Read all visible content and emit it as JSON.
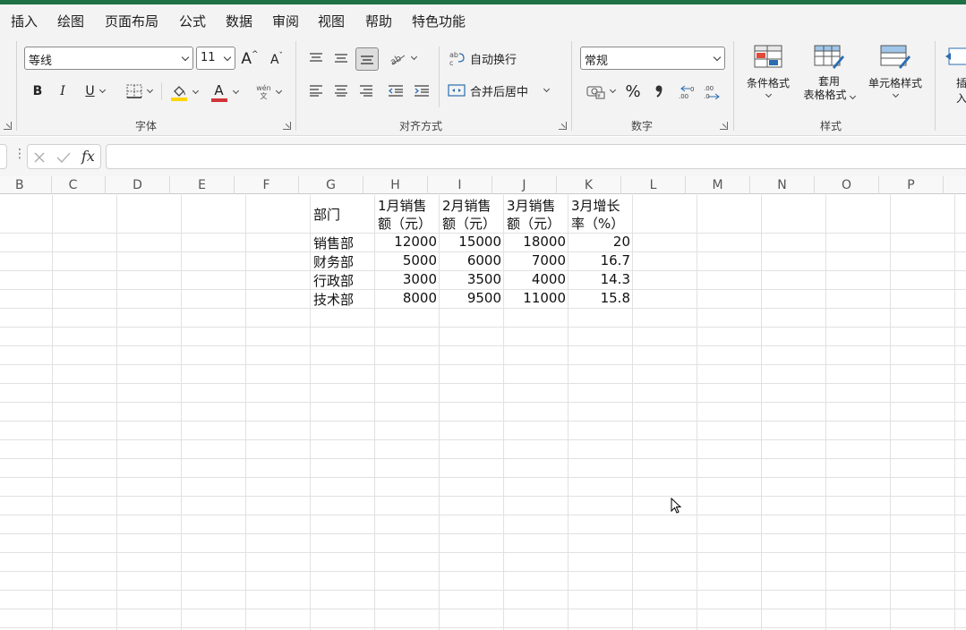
{
  "menu": {
    "items": [
      "插入",
      "绘图",
      "页面布局",
      "公式",
      "数据",
      "审阅",
      "视图",
      "帮助",
      "特色功能"
    ]
  },
  "ribbon": {
    "font": {
      "font_name": "等线",
      "font_size": "11",
      "group_label": "字体",
      "increase_size_glyph": "A",
      "decrease_size_glyph": "A",
      "bold": "B",
      "italic": "I",
      "underline": "U",
      "font_color_glyph": "A",
      "phonetic_glyph": "wén",
      "fill_color": "#ffd400",
      "font_color": "#d13438"
    },
    "alignment": {
      "wrap_text": "自动换行",
      "merge_center": "合并后居中",
      "group_label": "对齐方式"
    },
    "number": {
      "format": "常规",
      "percent": "%",
      "comma": "❯",
      "group_label": "数字"
    },
    "styles": {
      "conditional_format": "条件格式",
      "table_format_line1": "套用",
      "table_format_line2": "表格格式",
      "cell_styles": "单元格样式",
      "group_label": "样式"
    },
    "cells": {
      "insert": "插入"
    }
  },
  "formula_bar": {
    "fx": "fx",
    "value": ""
  },
  "columns": [
    "B",
    "C",
    "D",
    "E",
    "F",
    "G",
    "H",
    "I",
    "J",
    "K",
    "L",
    "M",
    "N",
    "O",
    "P"
  ],
  "table": {
    "headers": [
      [
        "部门",
        ""
      ],
      [
        "1月销售",
        "额（元）"
      ],
      [
        "2月销售",
        "额（元）"
      ],
      [
        "3月销售",
        "额（元）"
      ],
      [
        "3月增长",
        "率（%）"
      ]
    ],
    "rows": [
      [
        "销售部",
        "12000",
        "15000",
        "18000",
        "20"
      ],
      [
        "财务部",
        "5000",
        "6000",
        "7000",
        "16.7"
      ],
      [
        "行政部",
        "3000",
        "3500",
        "4000",
        "14.3"
      ],
      [
        "技术部",
        "8000",
        "9500",
        "11000",
        "15.8"
      ]
    ]
  },
  "colors": {
    "accent": "#1e7145"
  }
}
